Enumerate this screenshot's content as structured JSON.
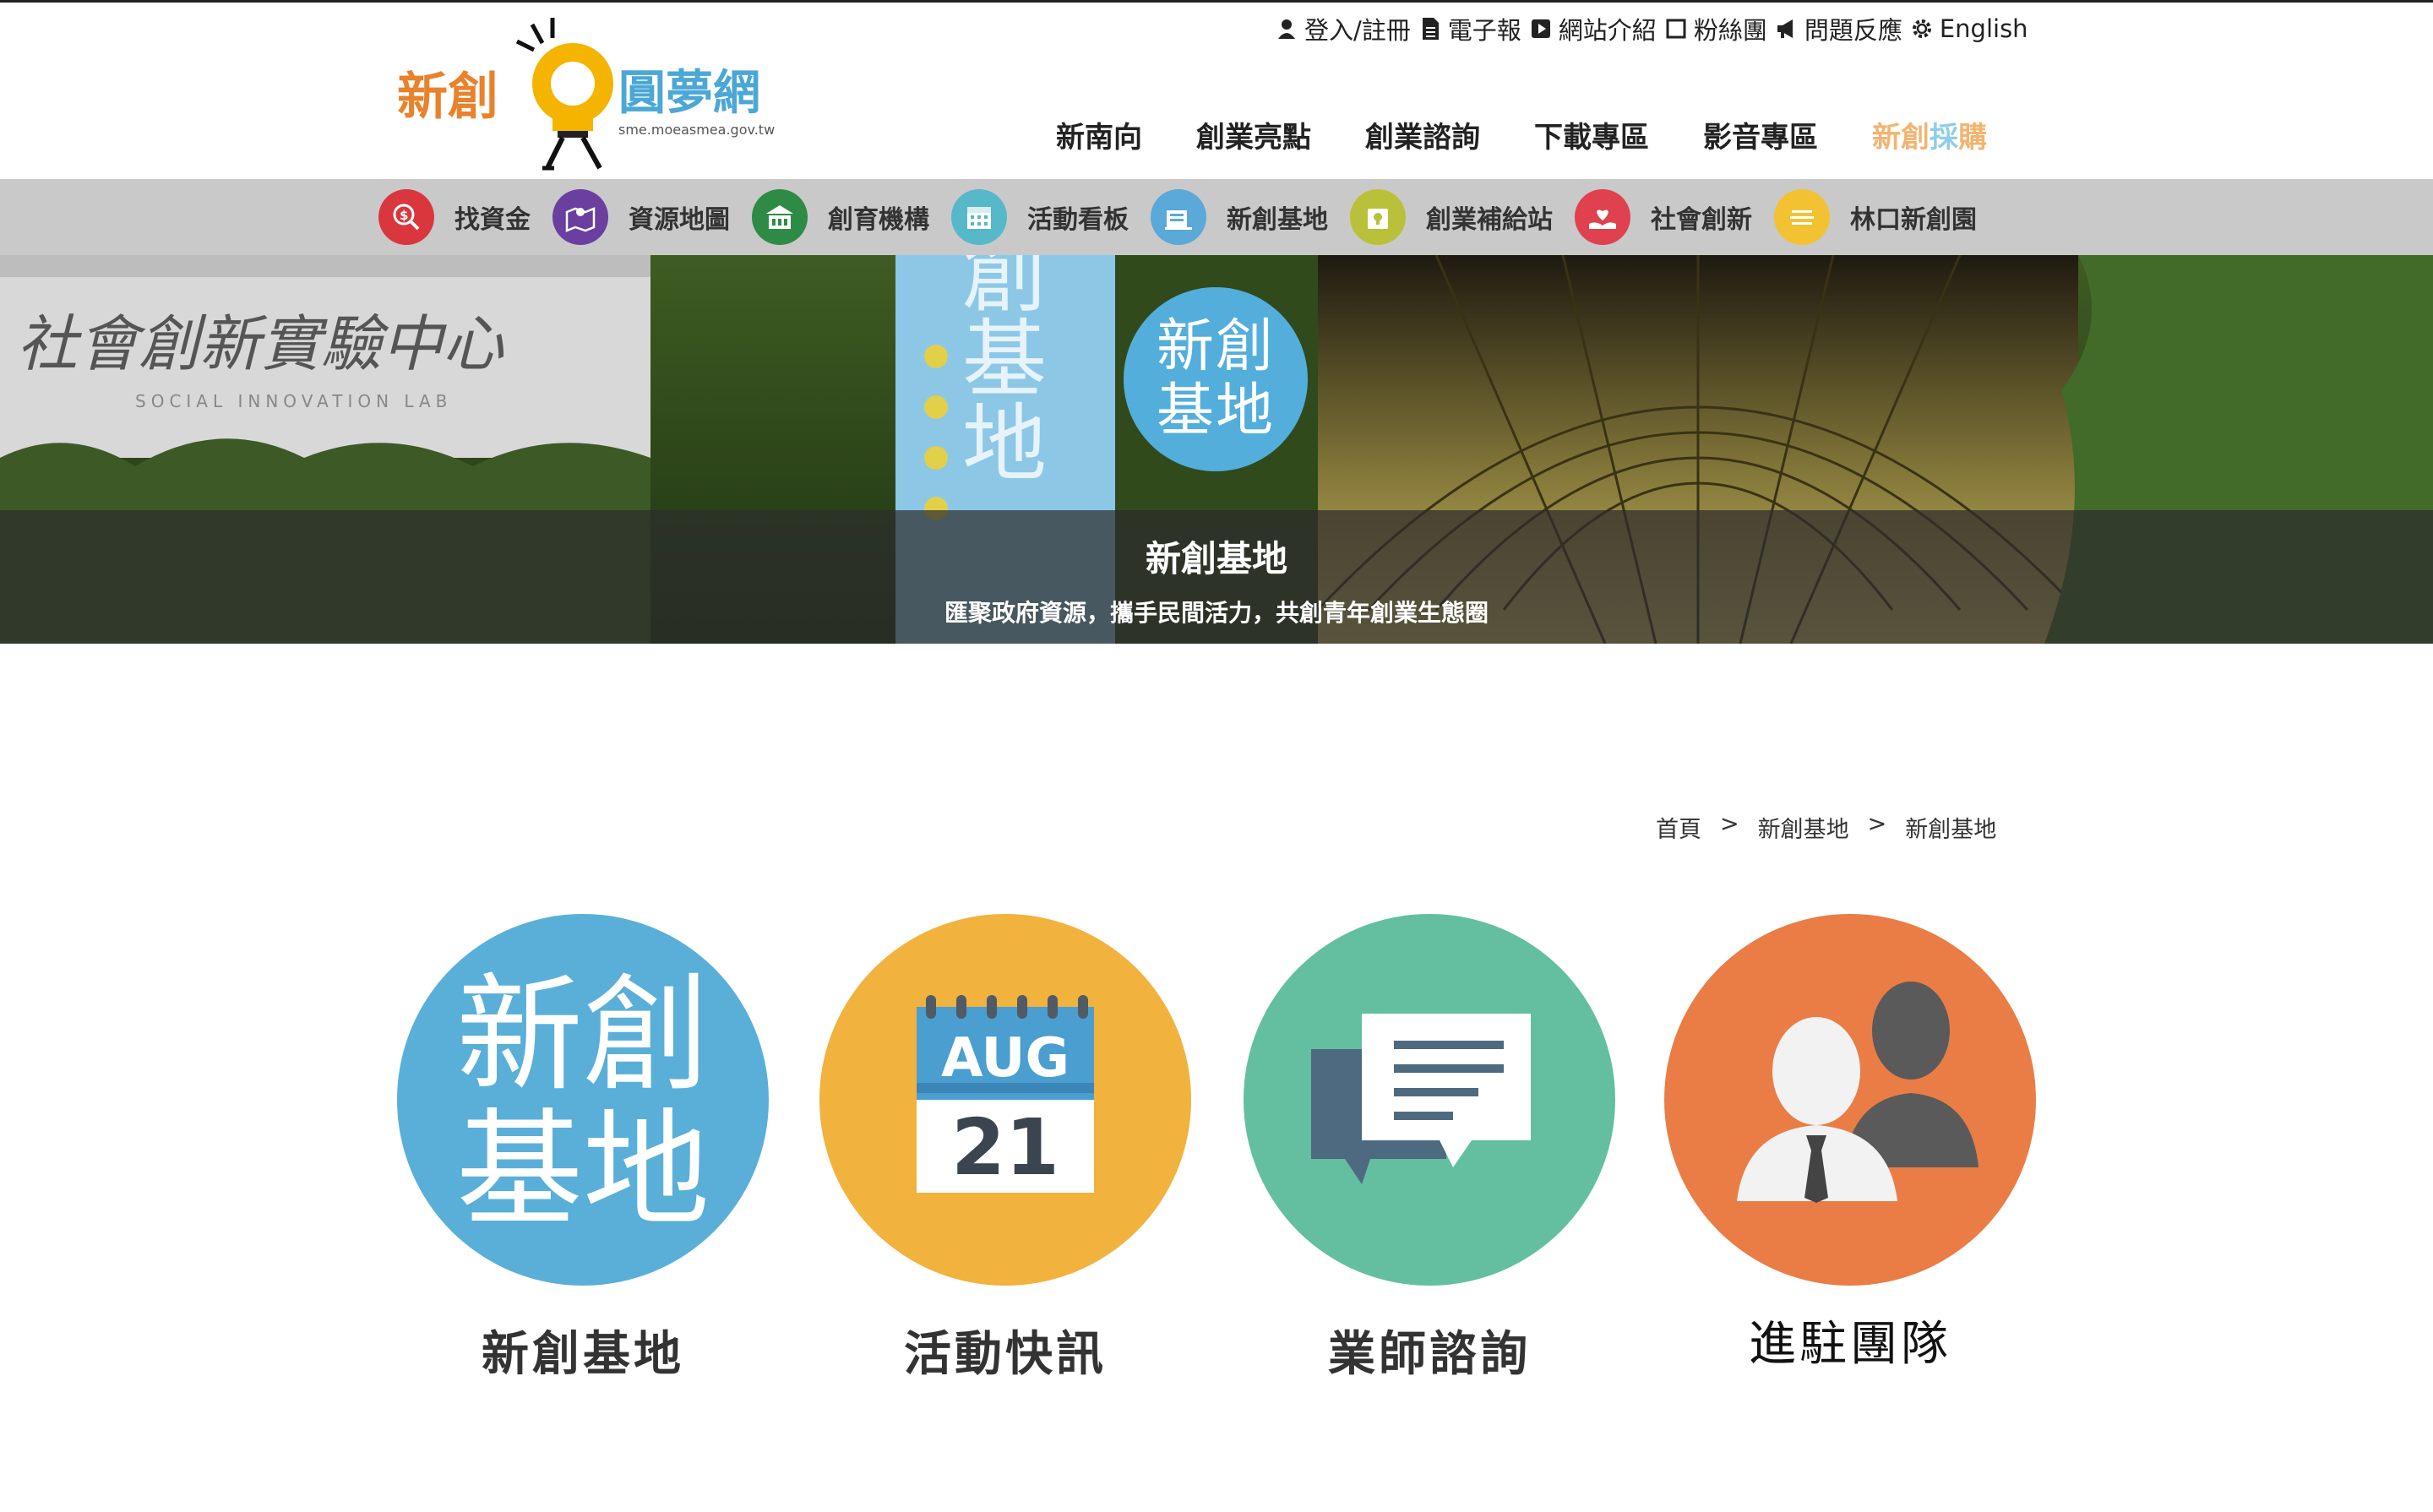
{
  "logo": {
    "name_left": "新創",
    "name_right": "圓夢網",
    "domain": "sme.moeasmea.gov.tw"
  },
  "topbar": {
    "items": [
      {
        "label": "登入/註冊",
        "icon": "user-icon"
      },
      {
        "label": "電子報",
        "icon": "document-icon"
      },
      {
        "label": "網站介紹",
        "icon": "play-icon"
      },
      {
        "label": "粉絲團",
        "icon": "square-icon"
      },
      {
        "label": "問題反應",
        "icon": "megaphone-icon"
      },
      {
        "label": "English",
        "icon": "gear-icon"
      }
    ]
  },
  "mainnav": {
    "items": [
      "新南向",
      "創業亮點",
      "創業諮詢",
      "下載專區",
      "影音專區"
    ],
    "highlight_a": "新創",
    "highlight_b": "採",
    "highlight_c": "購"
  },
  "iconbar": {
    "items": [
      {
        "label": "找資金",
        "color": "#d9363e",
        "icon": "money-search-icon"
      },
      {
        "label": "資源地圖",
        "color": "#6a3fa0",
        "icon": "map-icon"
      },
      {
        "label": "創育機構",
        "color": "#2e8b45",
        "icon": "building-icon"
      },
      {
        "label": "活動看板",
        "color": "#56b8c8",
        "icon": "calendar-icon"
      },
      {
        "label": "新創基地",
        "color": "#5aa9d9",
        "icon": "base-icon"
      },
      {
        "label": "創業補給站",
        "color": "#b9c13a",
        "icon": "supply-icon"
      },
      {
        "label": "社會創新",
        "color": "#e0414f",
        "icon": "heart-hand-icon"
      },
      {
        "label": "林口新創園",
        "color": "#f2c232",
        "icon": "park-icon"
      }
    ]
  },
  "banner": {
    "badge_line1": "新創",
    "badge_line2": "基地",
    "title": "新創基地",
    "subtitle": "匯聚政府資源，攜手民間活力，共創青年創業生態圈",
    "sign_text": "社會創新實驗中心",
    "sign_sub": "SOCIAL INNOVATION LAB",
    "pillar_text": "新創基地"
  },
  "breadcrumb": [
    "首頁",
    "新創基地",
    "新創基地"
  ],
  "breadcrumb_sep": ">",
  "cards": [
    {
      "title": "新創基地",
      "icon_line1": "新創",
      "icon_line2": "基地",
      "color": "#5aafd9"
    },
    {
      "title": "活動快訊",
      "month": "AUG",
      "day": "21",
      "color": "#f1b23e"
    },
    {
      "title": "業師諮詢",
      "color": "#63bf9f"
    },
    {
      "title": "進駐團隊",
      "color": "#ea7d45"
    }
  ]
}
